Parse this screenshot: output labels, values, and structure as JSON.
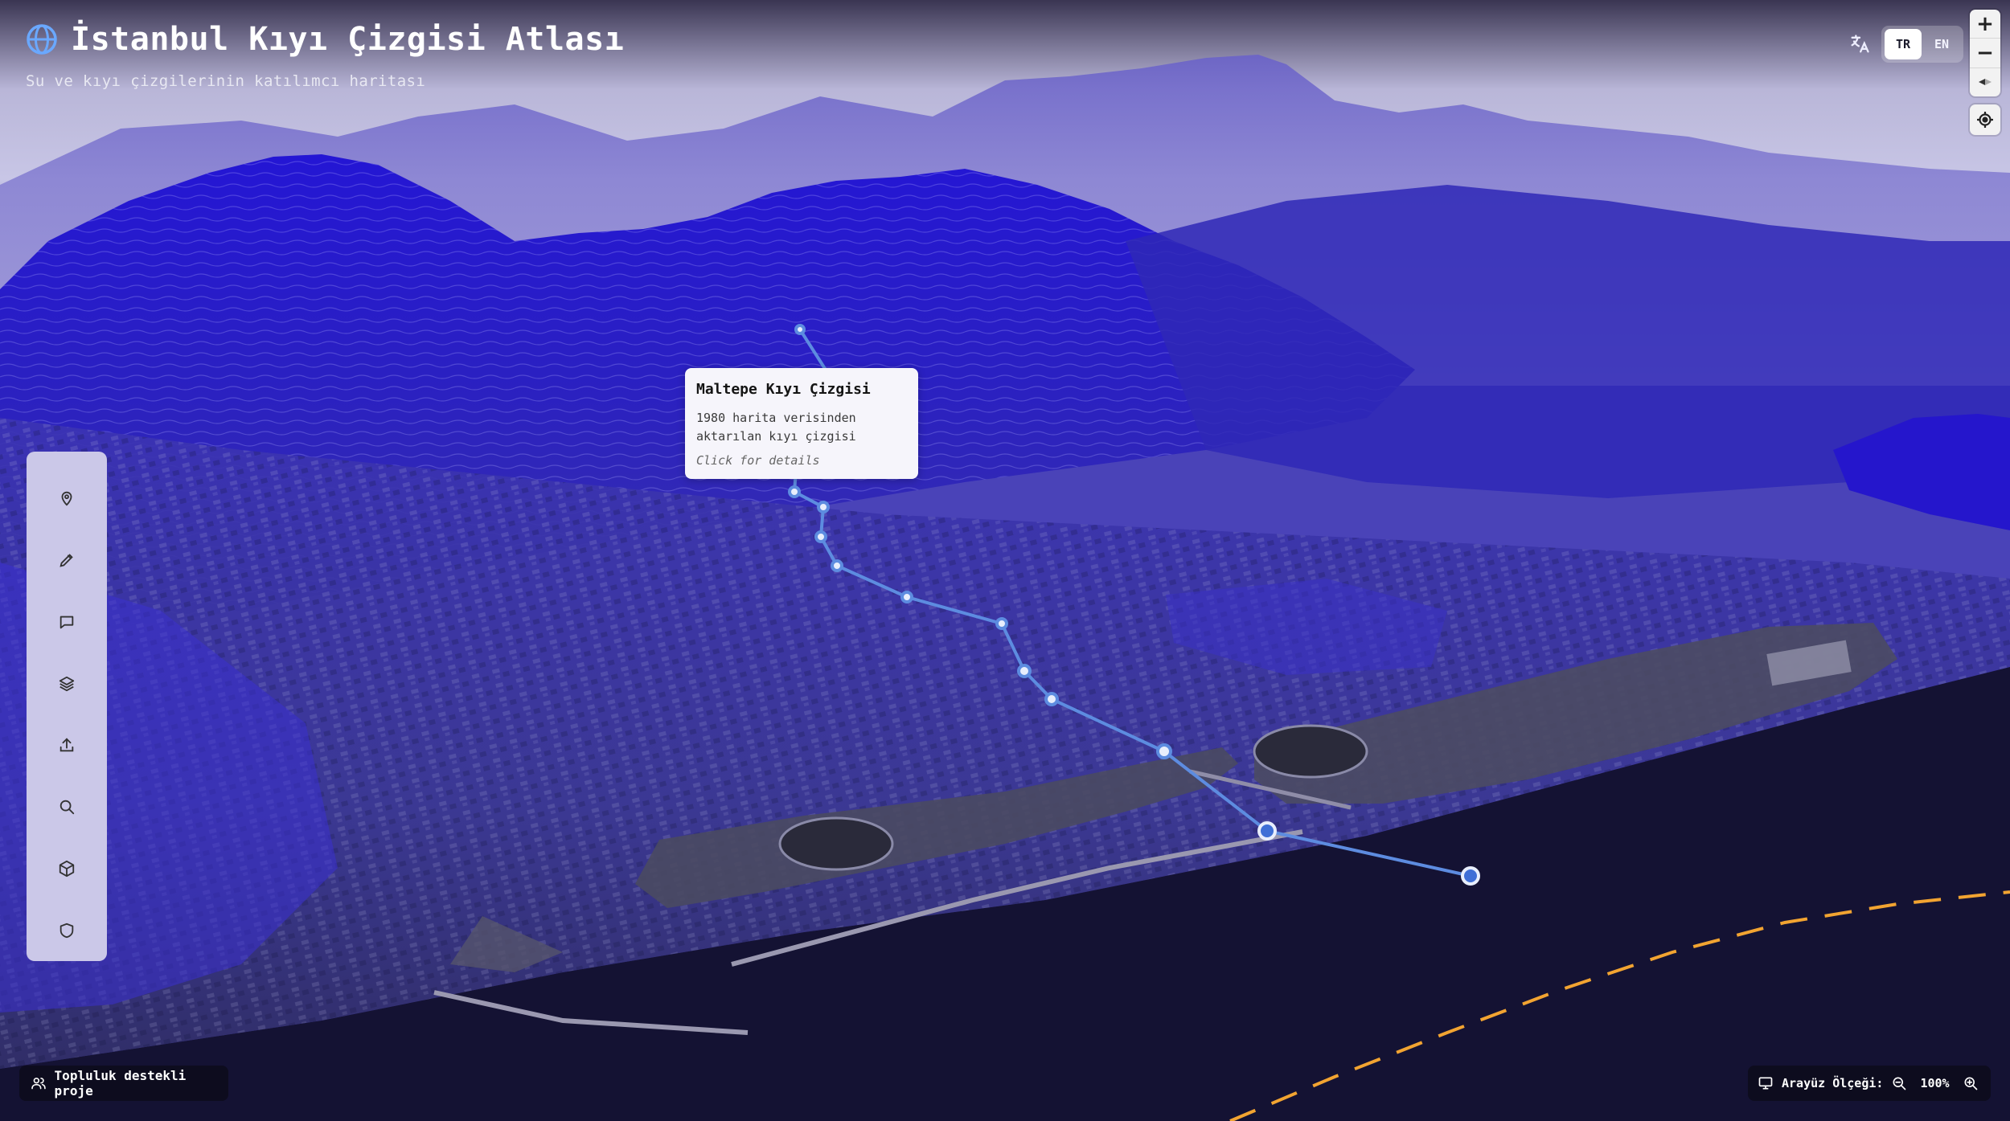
{
  "header": {
    "title": "İstanbul Kıyı Çizgisi Atlası",
    "subtitle": "Su ve kıyı çizgilerinin katılımcı haritası",
    "logo_icon": "globe-icon"
  },
  "language": {
    "icon": "translate-icon",
    "options": [
      "TR",
      "EN"
    ],
    "selected": "TR"
  },
  "map_controls": {
    "zoom_in": "+",
    "zoom_out": "−",
    "compass": "compass-icon",
    "locate": "locate-icon"
  },
  "toolbar": {
    "items": [
      {
        "name": "location",
        "icon": "map-pin-icon"
      },
      {
        "name": "draw",
        "icon": "pencil-icon"
      },
      {
        "name": "comment",
        "icon": "message-icon"
      },
      {
        "name": "layers",
        "icon": "layers-icon"
      },
      {
        "name": "upload",
        "icon": "upload-icon"
      },
      {
        "name": "search",
        "icon": "search-icon"
      },
      {
        "name": "3d-view",
        "icon": "cube-icon"
      },
      {
        "name": "security",
        "icon": "shield-icon"
      }
    ]
  },
  "popup": {
    "title": "Maltepe Kıyı Çizgisi",
    "description": "1980 harita verisinden\naktarılan kıyı çizgisi",
    "link": "Click for details"
  },
  "footer": {
    "community_label": "Topluluk destekli proje",
    "community_icon": "users-icon",
    "scale_label": "Arayüz Ölçeği:",
    "scale_value": "100%",
    "scale_icon": "monitor-icon",
    "zoom_out_icon": "zoom-out-icon",
    "zoom_in_icon": "zoom-in-icon"
  },
  "colors": {
    "terrain": "#2a1fd0",
    "sea": "#141233",
    "route": "#5b8de0",
    "dashed_line": "#f5a623"
  }
}
